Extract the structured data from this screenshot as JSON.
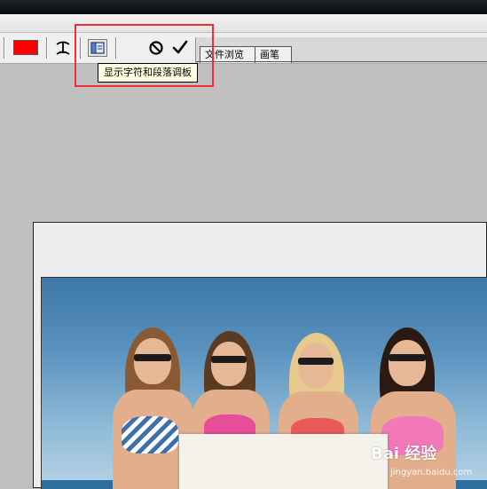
{
  "options_bar": {
    "text_color": "#ff0000",
    "tools": [
      {
        "name": "warp-text-icon"
      },
      {
        "name": "toggle-character-paragraph-palettes-icon"
      },
      {
        "name": "cancel-icon",
        "glyph": "⊘"
      },
      {
        "name": "commit-icon",
        "glyph": "✓"
      }
    ]
  },
  "palette_well": {
    "tabs": [
      {
        "label": "文件浏览"
      },
      {
        "label": "画笔"
      }
    ]
  },
  "tooltip": {
    "text": "显示字符和段落调板"
  },
  "annotation": {
    "highlight_color": "#f03030"
  },
  "watermark": {
    "main": "Bai 经验",
    "sub": "jingyan.baidu.com"
  }
}
